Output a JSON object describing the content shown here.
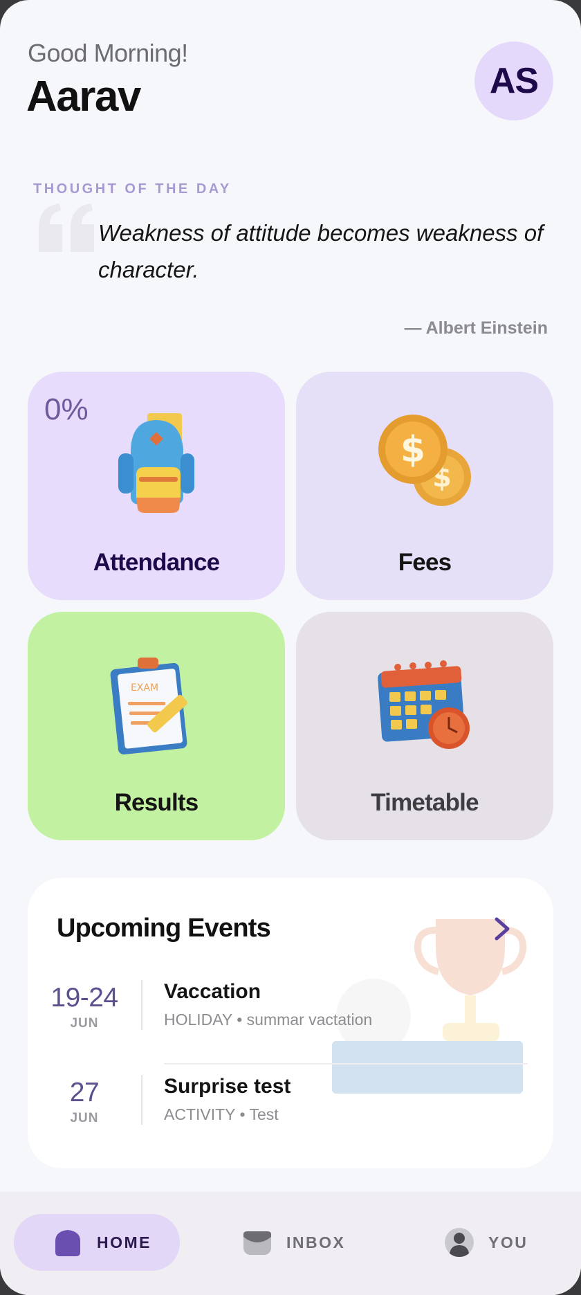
{
  "header": {
    "greeting": "Good Morning!",
    "name": "Aarav",
    "avatar_initials": "AS"
  },
  "thought": {
    "label": "THOUGHT OF THE DAY",
    "quote": "Weakness of attitude becomes weakness of character.",
    "author": "— Albert Einstein"
  },
  "tiles": {
    "attendance": {
      "label": "Attendance",
      "value": "0%",
      "icon": "backpack-icon"
    },
    "fees": {
      "label": "Fees",
      "icon": "coins-icon"
    },
    "results": {
      "label": "Results",
      "icon": "exam-clipboard-icon"
    },
    "timetable": {
      "label": "Timetable",
      "icon": "calendar-clock-icon"
    }
  },
  "events": {
    "title": "Upcoming Events",
    "items": [
      {
        "date": "19-24",
        "month": "JUN",
        "title": "Vaccation",
        "subtitle": "HOLIDAY • summar vactation"
      },
      {
        "date": "27",
        "month": "JUN",
        "title": "Surprise test",
        "subtitle": "ACTIVITY • Test"
      }
    ]
  },
  "nav": {
    "home": "HOME",
    "inbox": "INBOX",
    "you": "YOU"
  },
  "colors": {
    "background": "#f6f7fa",
    "accent_purple": "#e4d9fb",
    "results_green": "#c2f1a1",
    "timetable_gray": "#e5e1e6",
    "navbar": "#f1eef3"
  }
}
